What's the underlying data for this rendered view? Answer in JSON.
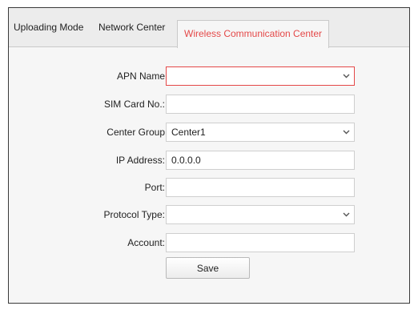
{
  "tabs": {
    "uploading_mode": "Uploading Mode",
    "network_center": "Network Center",
    "wireless_center": "Wireless Communication Center",
    "active_color": "#e44848"
  },
  "form": {
    "apn_name": {
      "label": "APN Name",
      "value": ""
    },
    "sim_card": {
      "label": "SIM Card No.:",
      "value": ""
    },
    "center_group": {
      "label": "Center Group",
      "value": "Center1"
    },
    "ip_address": {
      "label": "IP Address:",
      "value": "0.0.0.0"
    },
    "port": {
      "label": "Port:",
      "value": ""
    },
    "protocol_type": {
      "label": "Protocol Type:",
      "value": ""
    },
    "account": {
      "label": "Account:",
      "value": ""
    }
  },
  "actions": {
    "save_label": "Save"
  },
  "icons": {
    "dropdown": "chevron-down-icon"
  }
}
